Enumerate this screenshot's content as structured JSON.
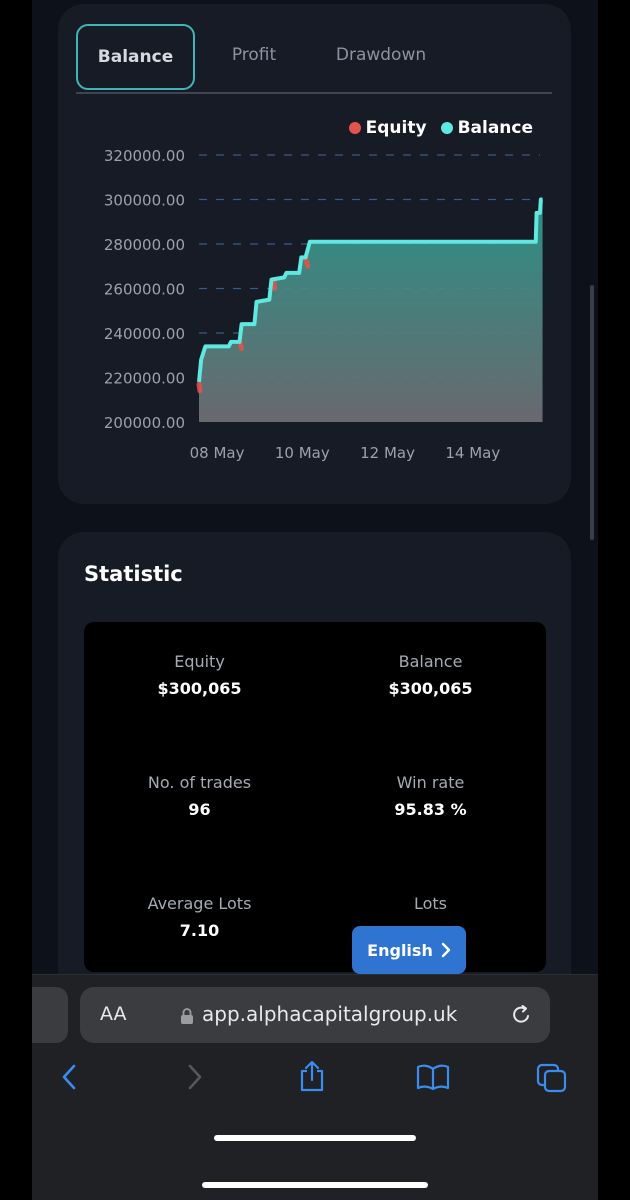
{
  "tabs": [
    {
      "label": "Balance",
      "active": true
    },
    {
      "label": "Profit",
      "active": false
    },
    {
      "label": "Drawdown",
      "active": false
    }
  ],
  "legend": [
    {
      "label": "Equity",
      "color": "#e5534b"
    },
    {
      "label": "Balance",
      "color": "#5ee8e0"
    }
  ],
  "chart_data": {
    "type": "area",
    "y_ticks": [
      "320000.00",
      "300000.00",
      "280000.00",
      "260000.00",
      "240000.00",
      "220000.00",
      "200000.00"
    ],
    "x_ticks": [
      "08 May",
      "10 May",
      "12 May",
      "14 May"
    ],
    "ylim": [
      200000,
      320000
    ],
    "xlim": [
      7.6,
      15.6
    ],
    "grid": true,
    "legend_position": "top-right",
    "series": [
      {
        "name": "Balance",
        "color": "#5ee8e0",
        "x": [
          7.6,
          7.65,
          7.75,
          8.3,
          8.35,
          8.55,
          8.6,
          8.9,
          8.95,
          9.25,
          9.3,
          9.6,
          9.65,
          9.95,
          10.0,
          10.1,
          10.2,
          11.0,
          11.5,
          12.5,
          13.5,
          14.5,
          15.5,
          15.52,
          15.6,
          15.62,
          15.66
        ],
        "y": [
          218000,
          228000,
          234000,
          234000,
          236000,
          236000,
          244000,
          244000,
          254000,
          255000,
          264000,
          265000,
          267000,
          267000,
          274000,
          274000,
          281000,
          281000,
          281000,
          281000,
          281000,
          281000,
          281000,
          294000,
          294000,
          300000,
          300000
        ]
      },
      {
        "name": "Equity",
        "color": "#e5534b",
        "x": [
          7.6,
          7.62,
          8.56,
          8.6,
          9.35,
          9.38,
          10.1,
          10.15
        ],
        "y": [
          217000,
          214000,
          236000,
          233000,
          264000,
          260000,
          274000,
          270000
        ]
      }
    ]
  },
  "statistic": {
    "title": "Statistic",
    "items": [
      {
        "label": "Equity",
        "value": "$300,065"
      },
      {
        "label": "Balance",
        "value": "$300,065"
      },
      {
        "label": "No. of trades",
        "value": "96"
      },
      {
        "label": "Win rate",
        "value": "95.83 %"
      },
      {
        "label": "Average Lots",
        "value": "7.10"
      },
      {
        "label": "Lots",
        "value": ""
      }
    ]
  },
  "language_button": {
    "label": "English"
  },
  "browser": {
    "aa": "AA",
    "url": "app.alphacapitalgroup.uk"
  },
  "icons": {
    "lock": "lock-icon",
    "reload": "reload-icon",
    "back": "back-chevron-icon",
    "forward": "forward-chevron-icon",
    "share": "share-icon",
    "bookmarks": "book-icon",
    "tabs": "tabs-icon"
  }
}
